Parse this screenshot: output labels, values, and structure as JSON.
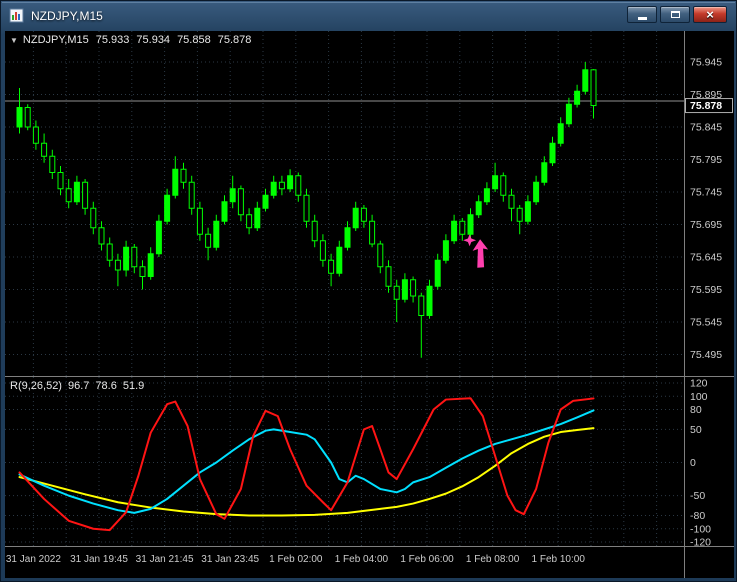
{
  "window": {
    "title": "NZDJPY,M15",
    "buttons": {
      "minimize": "minimize",
      "maximize": "maximize",
      "close": "close"
    },
    "icons": {
      "close_glyph": "×"
    }
  },
  "header": {
    "icon": "▼",
    "symbol": "NZDJPY,M15",
    "open": "75.933",
    "high": "75.934",
    "low": "75.858",
    "close": "75.878"
  },
  "indicator_header": {
    "name": "R(9,26,52)",
    "values": [
      "96.7",
      "78.6",
      "51.9"
    ]
  },
  "price_axis": {
    "labels": [
      "75.945",
      "75.895",
      "75.845",
      "75.795",
      "75.745",
      "75.695",
      "75.645",
      "75.595",
      "75.545",
      "75.495"
    ],
    "max": 75.945,
    "step": 0.05,
    "current_price": "75.878",
    "bid_line_price": 75.885
  },
  "indicator_axis": {
    "labels": [
      "120",
      "100",
      "80",
      "50",
      "0",
      "-50",
      "-80",
      "-100",
      "-120"
    ],
    "values": [
      120,
      100,
      80,
      50,
      0,
      -50,
      -80,
      -100,
      -120
    ]
  },
  "time_axis": {
    "labels": [
      "31 Jan 2022",
      "31 Jan 19:45",
      "31 Jan 21:45",
      "31 Jan 23:45",
      "1 Feb 02:00",
      "1 Feb 04:00",
      "1 Feb 06:00",
      "1 Feb 08:00",
      "1 Feb 10:00"
    ],
    "label_bars": [
      2,
      10,
      18,
      26,
      34,
      42,
      50,
      58,
      66
    ]
  },
  "marker": {
    "type": "buy-arrow",
    "bar": 55.5,
    "price": 75.68
  },
  "colors": {
    "grid": "#2b3844",
    "axis_text": "#cccccc",
    "separator": "#7f7f7f",
    "bull": "#00ff00",
    "bear_fill": "#000000",
    "candle_outline": "#00ff00",
    "bid_line": "#909090",
    "price_box_border": "#b0b0b0",
    "price_box_text": "#ffffff",
    "arrow": "#ff3fae",
    "series_red": "#ff1414",
    "series_cyan": "#00e0ff",
    "series_yellow": "#ffff00"
  },
  "chart_data": {
    "type": "candlestick",
    "symbol": "NZDJPY",
    "timeframe": "M15",
    "last_bar_ohlc": {
      "open": 75.933,
      "high": 75.934,
      "low": 75.858,
      "close": 75.878
    },
    "price_range": [
      75.495,
      75.945
    ],
    "candles": [
      [
        75.845,
        75.905,
        75.835,
        75.875
      ],
      [
        75.875,
        75.88,
        75.84,
        75.845
      ],
      [
        75.845,
        75.855,
        75.81,
        75.82
      ],
      [
        75.82,
        75.835,
        75.79,
        75.8
      ],
      [
        75.8,
        75.81,
        75.765,
        75.775
      ],
      [
        75.775,
        75.785,
        75.74,
        75.75
      ],
      [
        75.75,
        75.765,
        75.72,
        75.73
      ],
      [
        75.73,
        75.77,
        75.725,
        75.76
      ],
      [
        75.76,
        75.765,
        75.71,
        75.72
      ],
      [
        75.72,
        75.73,
        75.68,
        75.69
      ],
      [
        75.69,
        75.7,
        75.655,
        75.665
      ],
      [
        75.665,
        75.675,
        75.63,
        75.64
      ],
      [
        75.64,
        75.65,
        75.6,
        75.625
      ],
      [
        75.625,
        75.67,
        75.615,
        75.66
      ],
      [
        75.66,
        75.665,
        75.62,
        75.63
      ],
      [
        75.63,
        75.64,
        75.595,
        75.615
      ],
      [
        75.615,
        75.66,
        75.61,
        75.65
      ],
      [
        75.65,
        75.71,
        75.645,
        75.7
      ],
      [
        75.7,
        75.75,
        75.695,
        75.74
      ],
      [
        75.74,
        75.8,
        75.735,
        75.78
      ],
      [
        75.78,
        75.79,
        75.75,
        75.76
      ],
      [
        75.76,
        75.77,
        75.71,
        75.72
      ],
      [
        75.72,
        75.73,
        75.67,
        75.68
      ],
      [
        75.68,
        75.69,
        75.64,
        75.66
      ],
      [
        75.66,
        75.71,
        75.655,
        75.7
      ],
      [
        75.7,
        75.74,
        75.695,
        75.73
      ],
      [
        75.73,
        75.77,
        75.72,
        75.75
      ],
      [
        75.75,
        75.755,
        75.7,
        75.71
      ],
      [
        75.71,
        75.72,
        75.68,
        75.69
      ],
      [
        75.69,
        75.73,
        75.685,
        75.72
      ],
      [
        75.72,
        75.75,
        75.715,
        75.74
      ],
      [
        75.74,
        75.77,
        75.735,
        75.76
      ],
      [
        75.76,
        75.77,
        75.74,
        75.75
      ],
      [
        75.75,
        75.78,
        75.745,
        75.77
      ],
      [
        75.77,
        75.775,
        75.73,
        75.74
      ],
      [
        75.74,
        75.75,
        75.69,
        75.7
      ],
      [
        75.7,
        75.71,
        75.66,
        75.67
      ],
      [
        75.67,
        75.68,
        75.63,
        75.64
      ],
      [
        75.64,
        75.65,
        75.6,
        75.62
      ],
      [
        75.62,
        75.67,
        75.615,
        75.66
      ],
      [
        75.66,
        75.7,
        75.655,
        75.69
      ],
      [
        75.69,
        75.73,
        75.685,
        75.72
      ],
      [
        75.72,
        75.725,
        75.69,
        75.7
      ],
      [
        75.7,
        75.71,
        75.66,
        75.665
      ],
      [
        75.665,
        75.67,
        75.62,
        75.63
      ],
      [
        75.63,
        75.64,
        75.59,
        75.6
      ],
      [
        75.6,
        75.61,
        75.545,
        75.58
      ],
      [
        75.58,
        75.62,
        75.575,
        75.61
      ],
      [
        75.61,
        75.615,
        75.575,
        75.585
      ],
      [
        75.585,
        75.59,
        75.49,
        75.555
      ],
      [
        75.555,
        75.61,
        75.55,
        75.6
      ],
      [
        75.6,
        75.65,
        75.595,
        75.64
      ],
      [
        75.64,
        75.68,
        75.635,
        75.67
      ],
      [
        75.67,
        75.71,
        75.665,
        75.7
      ],
      [
        75.7,
        75.705,
        75.67,
        75.68
      ],
      [
        75.68,
        75.72,
        75.675,
        75.71
      ],
      [
        75.71,
        75.74,
        75.705,
        75.73
      ],
      [
        75.73,
        75.76,
        75.725,
        75.75
      ],
      [
        75.75,
        75.79,
        75.745,
        75.77
      ],
      [
        75.77,
        75.775,
        75.73,
        75.74
      ],
      [
        75.74,
        75.75,
        75.7,
        75.72
      ],
      [
        75.72,
        75.725,
        75.68,
        75.7
      ],
      [
        75.7,
        75.74,
        75.695,
        75.73
      ],
      [
        75.73,
        75.77,
        75.725,
        75.76
      ],
      [
        75.76,
        75.8,
        75.755,
        75.79
      ],
      [
        75.79,
        75.83,
        75.785,
        75.82
      ],
      [
        75.82,
        75.86,
        75.815,
        75.85
      ],
      [
        75.85,
        75.89,
        75.845,
        75.88
      ],
      [
        75.88,
        75.91,
        75.875,
        75.9
      ],
      [
        75.9,
        75.945,
        75.895,
        75.933
      ],
      [
        75.933,
        75.934,
        75.858,
        75.878
      ]
    ],
    "indicator": {
      "name": "R(9,26,52)",
      "range": [
        -120,
        120
      ],
      "current_values": [
        96.7,
        78.6,
        51.9
      ],
      "series": [
        {
          "name": "slow",
          "color_key": "series_yellow",
          "points": [
            [
              0,
              -22
            ],
            [
              4,
              -35
            ],
            [
              8,
              -48
            ],
            [
              12,
              -60
            ],
            [
              16,
              -68
            ],
            [
              20,
              -74
            ],
            [
              24,
              -78
            ],
            [
              28,
              -80
            ],
            [
              32,
              -80
            ],
            [
              36,
              -79
            ],
            [
              40,
              -76
            ],
            [
              42,
              -73
            ],
            [
              44,
              -70
            ],
            [
              46,
              -67
            ],
            [
              48,
              -62
            ],
            [
              50,
              -55
            ],
            [
              52,
              -47
            ],
            [
              54,
              -36
            ],
            [
              56,
              -22
            ],
            [
              58,
              -5
            ],
            [
              60,
              14
            ],
            [
              62,
              28
            ],
            [
              64,
              39
            ],
            [
              66,
              46
            ],
            [
              68,
              49
            ],
            [
              70,
              51.9
            ]
          ]
        },
        {
          "name": "medium",
          "color_key": "series_cyan",
          "points": [
            [
              0,
              -18
            ],
            [
              3,
              -35
            ],
            [
              6,
              -50
            ],
            [
              9,
              -62
            ],
            [
              12,
              -72
            ],
            [
              14,
              -76
            ],
            [
              16,
              -70
            ],
            [
              18,
              -55
            ],
            [
              20,
              -35
            ],
            [
              22,
              -15
            ],
            [
              24,
              0
            ],
            [
              26,
              18
            ],
            [
              28,
              35
            ],
            [
              30,
              48
            ],
            [
              31,
              50
            ],
            [
              33,
              46
            ],
            [
              35,
              42
            ],
            [
              36,
              35
            ],
            [
              38,
              0
            ],
            [
              39,
              -25
            ],
            [
              40,
              -30
            ],
            [
              41,
              -20
            ],
            [
              42,
              -25
            ],
            [
              44,
              -40
            ],
            [
              46,
              -45
            ],
            [
              47,
              -40
            ],
            [
              48,
              -30
            ],
            [
              50,
              -22
            ],
            [
              52,
              -8
            ],
            [
              54,
              6
            ],
            [
              56,
              18
            ],
            [
              58,
              28
            ],
            [
              60,
              35
            ],
            [
              62,
              42
            ],
            [
              64,
              50
            ],
            [
              66,
              58
            ],
            [
              68,
              68
            ],
            [
              70,
              78.6
            ]
          ]
        },
        {
          "name": "fast",
          "color_key": "series_red",
          "points": [
            [
              0,
              -15
            ],
            [
              3,
              -55
            ],
            [
              6,
              -88
            ],
            [
              9,
              -100
            ],
            [
              11,
              -102
            ],
            [
              13,
              -75
            ],
            [
              14.5,
              -20
            ],
            [
              16,
              45
            ],
            [
              18,
              88
            ],
            [
              19,
              92
            ],
            [
              20.5,
              55
            ],
            [
              22,
              -25
            ],
            [
              24,
              -78
            ],
            [
              25,
              -85
            ],
            [
              27,
              -40
            ],
            [
              28.5,
              40
            ],
            [
              30,
              78
            ],
            [
              31.5,
              70
            ],
            [
              33,
              20
            ],
            [
              35,
              -35
            ],
            [
              37,
              -60
            ],
            [
              38,
              -72
            ],
            [
              40,
              -30
            ],
            [
              42,
              50
            ],
            [
              43,
              55
            ],
            [
              45,
              -15
            ],
            [
              46,
              -25
            ],
            [
              48,
              20
            ],
            [
              50.5,
              80
            ],
            [
              52,
              95
            ],
            [
              55,
              97
            ],
            [
              56.5,
              70
            ],
            [
              58.5,
              -10
            ],
            [
              59.5,
              -50
            ],
            [
              60.5,
              -72
            ],
            [
              61.5,
              -78
            ],
            [
              63,
              -40
            ],
            [
              64.5,
              30
            ],
            [
              66,
              80
            ],
            [
              67.5,
              93
            ],
            [
              70,
              96.7
            ]
          ]
        }
      ]
    }
  }
}
